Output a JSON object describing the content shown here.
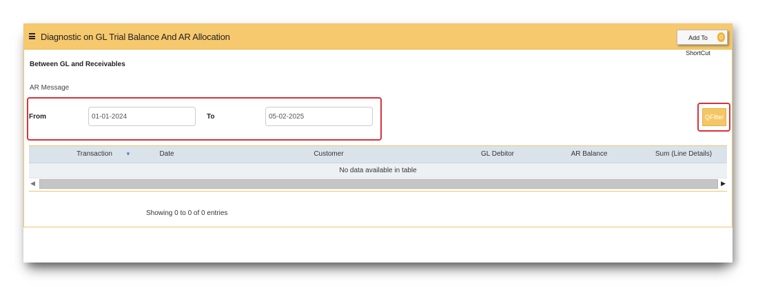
{
  "header": {
    "title": "Diagnostic on GL Trial Balance And AR Allocation",
    "shortcut_label": "Add To ShortCut",
    "shortcut_badge": "0"
  },
  "section": {
    "title": "Between GL and Receivables",
    "ar_message": "AR Message"
  },
  "filters": {
    "from_label": "From",
    "from_value": "01-01-2024",
    "to_label": "To",
    "to_value": "05-02-2025",
    "filter_button": "Filter"
  },
  "table": {
    "columns": [
      "Transaction",
      "Date",
      "Customer",
      "GL Debitor",
      "AR Balance",
      "Sum (Line Details)"
    ],
    "empty_message": "No data available in table",
    "info": "Showing 0 to 0 of 0 entries"
  },
  "icons": {
    "menu": "hamburger-menu-icon",
    "sort": "sort-desc-icon",
    "filter": "search-icon",
    "scroll_left": "chevron-left-icon",
    "scroll_right": "chevron-right-icon"
  },
  "colors": {
    "header_bg": "#f7c96e",
    "highlight_border": "#d8313a",
    "table_header_bg": "#dbe3ea",
    "filter_button_bg": "#f5c764"
  }
}
